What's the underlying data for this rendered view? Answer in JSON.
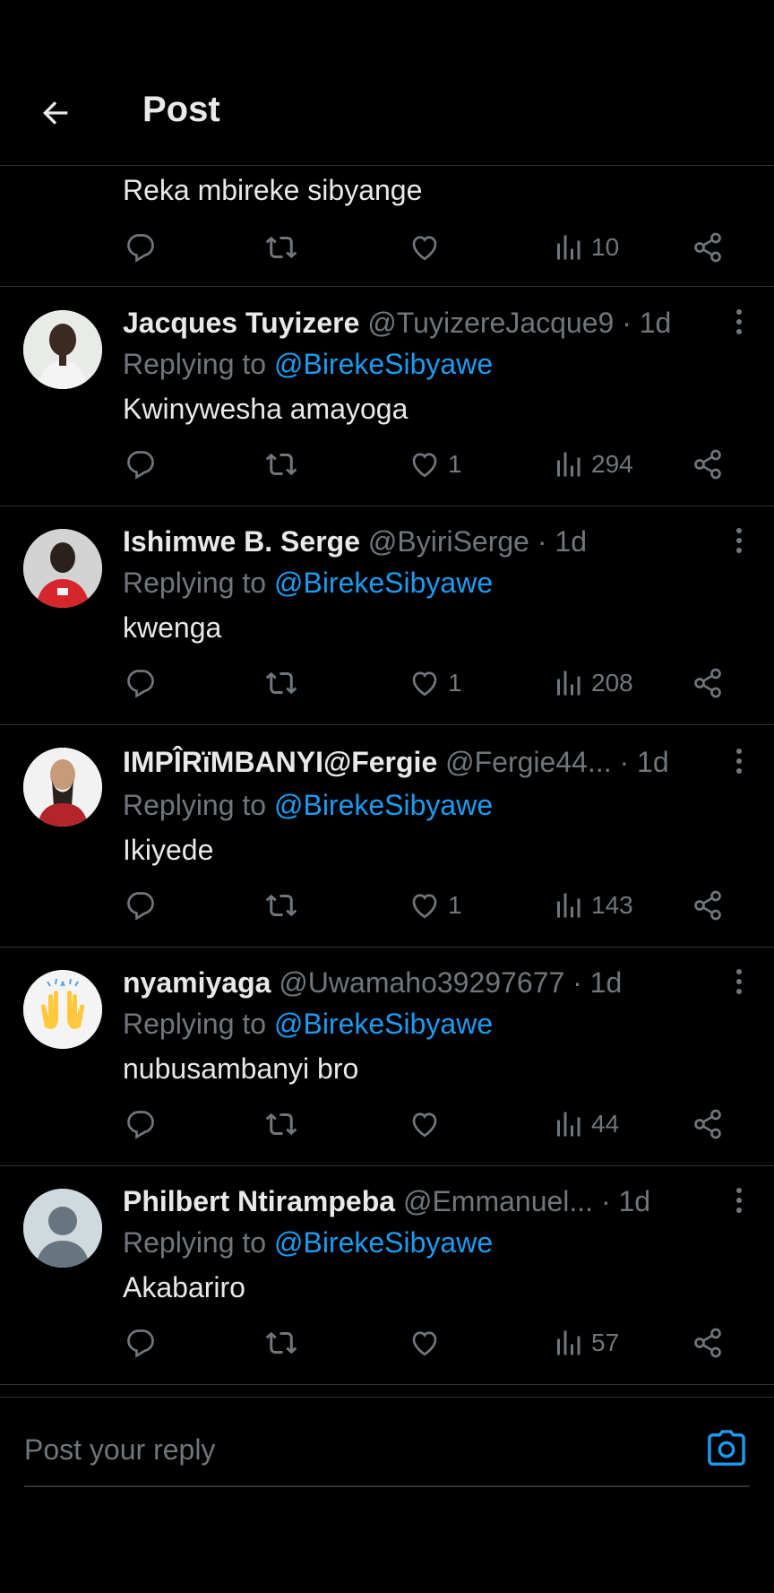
{
  "header": {
    "title": "Post"
  },
  "replies": [
    {
      "text": "Reka mbireke sibyange",
      "likes": "",
      "views": "10"
    },
    {
      "name": "Jacques Tuyizere",
      "handle": "@TuyizereJacque9",
      "time": "1d",
      "replying_prefix": "Replying to ",
      "replying_to": "@BirekeSibyawe",
      "text": "Kwinywesha amayoga",
      "likes": "1",
      "views": "294"
    },
    {
      "name": "Ishimwe B. Serge",
      "handle": "@ByiriSerge",
      "time": "1d",
      "replying_prefix": "Replying to ",
      "replying_to": "@BirekeSibyawe",
      "text": "kwenga",
      "likes": "1",
      "views": "208"
    },
    {
      "name": "IMPÎRïMBANYI@Fergie",
      "handle": "@Fergie44...",
      "time": "1d",
      "replying_prefix": "Replying to ",
      "replying_to": "@BirekeSibyawe",
      "text": "Ikiyede",
      "likes": "1",
      "views": "143"
    },
    {
      "name": "nyamiyaga",
      "handle": "@Uwamaho39297677",
      "time": "1d",
      "replying_prefix": "Replying to ",
      "replying_to": "@BirekeSibyawe",
      "text": "nubusambanyi bro",
      "likes": "",
      "views": "44"
    },
    {
      "name": "Philbert Ntirampeba",
      "handle": "@Emmanuel...",
      "time": "1d",
      "replying_prefix": "Replying to ",
      "replying_to": "@BirekeSibyawe",
      "text": "Akabariro",
      "likes": "",
      "views": "57"
    }
  ],
  "composer": {
    "placeholder": "Post your reply"
  },
  "colors": {
    "accent": "#1d9bf0",
    "muted": "#71767b",
    "text": "#e7e9ea",
    "divider": "#2f3336"
  },
  "icons": [
    "back-arrow-icon",
    "reply-icon",
    "repost-icon",
    "like-icon",
    "views-icon",
    "share-icon",
    "more-icon",
    "camera-icon"
  ]
}
